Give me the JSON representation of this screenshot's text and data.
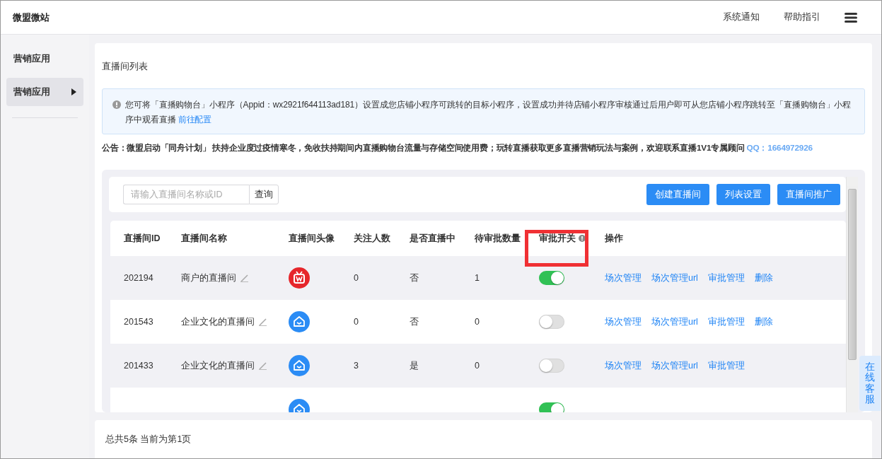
{
  "topbar": {
    "brand": "微盟微站",
    "links": [
      "系统通知",
      "帮助指引"
    ]
  },
  "sidebar": {
    "heading": "营销应用",
    "items": [
      {
        "label": "营销应用",
        "selected": true
      }
    ]
  },
  "page_title": "直播间列表",
  "info": {
    "text": "您可将「直播购物台」小程序（Appid：wx2921f644113ad181）设置成您店铺小程序可跳转的目标小程序，设置成功并待店铺小程序审核通过后用户即可从您店铺小程序跳转至「直播购物台」小程序中观看直播 ",
    "link": "前往配置"
  },
  "notice": {
    "text": "公告：微盟启动「同舟计划」 扶持企业度过疫情寒冬，免收扶持期间内直播购物台流量与存储空间使用费；玩转直播获取更多直播营销玩法与案例，欢迎联系直播1V1专属顾问 ",
    "contact": "QQ：1664972926"
  },
  "search": {
    "placeholder": "请输入直播间名称或ID",
    "button": "查询"
  },
  "actions": [
    "创建直播间",
    "列表设置",
    "直播间推广"
  ],
  "table": {
    "columns": [
      {
        "label": "直播间ID",
        "highlighted": false
      },
      {
        "label": "直播间名称",
        "highlighted": false
      },
      {
        "label": "直播间头像",
        "highlighted": false
      },
      {
        "label": "关注人数",
        "highlighted": false
      },
      {
        "label": "是否直播中",
        "highlighted": false
      },
      {
        "label": "待审批数量",
        "highlighted": false
      },
      {
        "label": "审批开关",
        "highlighted": true
      },
      {
        "label": "操作",
        "highlighted": false
      }
    ],
    "rows": [
      {
        "id": "202194",
        "name": "商户的直播间",
        "kind": "tv",
        "followers": "0",
        "live": "否",
        "pending": "1",
        "approval_on": true,
        "ops": [
          "场次管理",
          "场次管理url",
          "审批管理",
          "删除"
        ]
      },
      {
        "id": "201543",
        "name": "企业文化的直播间",
        "kind": "house",
        "followers": "0",
        "live": "否",
        "pending": "0",
        "approval_on": false,
        "ops": [
          "场次管理",
          "场次管理url",
          "审批管理",
          "删除"
        ]
      },
      {
        "id": "201433",
        "name": "企业文化的直播间",
        "kind": "house",
        "followers": "3",
        "live": "是",
        "pending": "0",
        "approval_on": false,
        "ops": [
          "场次管理",
          "场次管理url",
          "审批管理"
        ]
      },
      {
        "kind": "house",
        "approval_on": true
      }
    ]
  },
  "footer": "总共5条 当前为第1页",
  "service_tab": "在线客服"
}
